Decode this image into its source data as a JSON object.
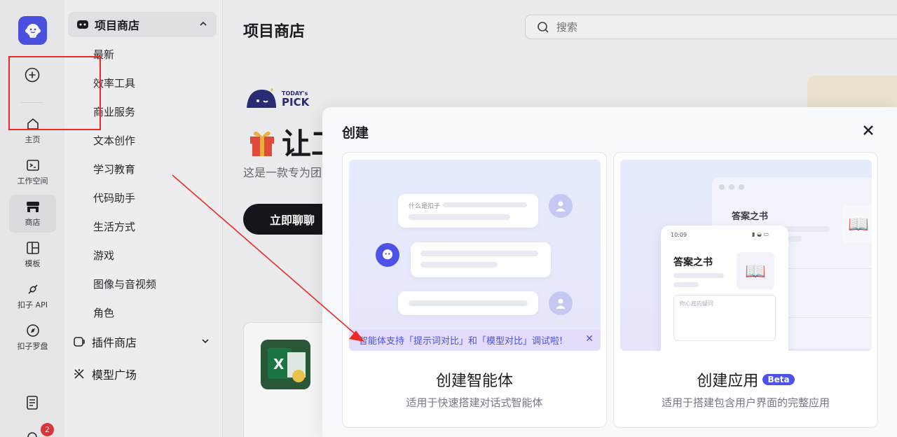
{
  "rail": {
    "items": [
      {
        "label": "主页",
        "icon": "home-icon"
      },
      {
        "label": "工作空间",
        "icon": "terminal-icon"
      },
      {
        "label": "商店",
        "icon": "store-icon"
      },
      {
        "label": "模板",
        "icon": "template-icon"
      },
      {
        "label": "扣子 API",
        "icon": "api-icon"
      },
      {
        "label": "扣子罗盘",
        "icon": "compass-icon"
      }
    ],
    "notification_count": "2"
  },
  "categories": {
    "project_store": "项目商店",
    "items": [
      "最新",
      "效率工具",
      "商业服务",
      "文本创作",
      "学习教育",
      "代码助手",
      "生活方式",
      "游戏",
      "图像与音视频",
      "角色"
    ],
    "plugin_store": "插件商店",
    "model_plaza": "模型广场"
  },
  "main": {
    "title": "项目商店",
    "search_placeholder": "搜索",
    "pick_top": "TODAY's",
    "pick_bottom": "PICK",
    "hero_title": "让工",
    "hero_sub": "这是一款专为团队",
    "chat_button": "立即聊聊"
  },
  "modal": {
    "title": "创建",
    "agent": {
      "name": "创建智能体",
      "desc": "适用于快速搭建对话式智能体",
      "chat_question": "什么是扣子",
      "notice": "智能体支持「提示词对比」和「模型对比」调试啦!"
    },
    "app": {
      "name": "创建应用",
      "badge": "Beta",
      "desc": "适用于搭建包含用户界面的完整应用",
      "window_title": "答案之书",
      "phone_time": "10:09",
      "phone_title": "答案之书",
      "input_placeholder": "你心底的疑问"
    }
  },
  "colors": {
    "brand": "#4d53e8",
    "annotation": "#ee2a24"
  }
}
